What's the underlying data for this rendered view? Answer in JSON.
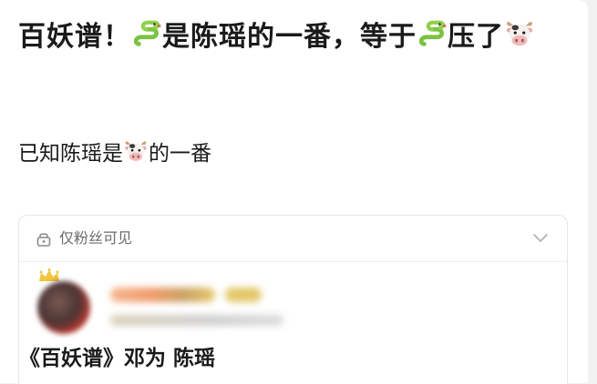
{
  "post": {
    "title_part1": "百妖谱！",
    "title_part2": "是陈瑶的一番，等于",
    "title_part3": "压了",
    "body_part1": "已知陈瑶是",
    "body_part2": "的一番",
    "emojis": [
      "snake-emoji",
      "snake-emoji",
      "cow-face-emoji",
      "cow-face-emoji"
    ]
  },
  "quoted_post": {
    "visibility_label": "仅粉丝可见",
    "text": "《百妖谱》邓为 陈瑶"
  },
  "colors": {
    "snake_green": "#7cc242",
    "card_background": "#ffffff",
    "page_background": "#f2f2f2",
    "muted_text": "#6b6b6b"
  }
}
